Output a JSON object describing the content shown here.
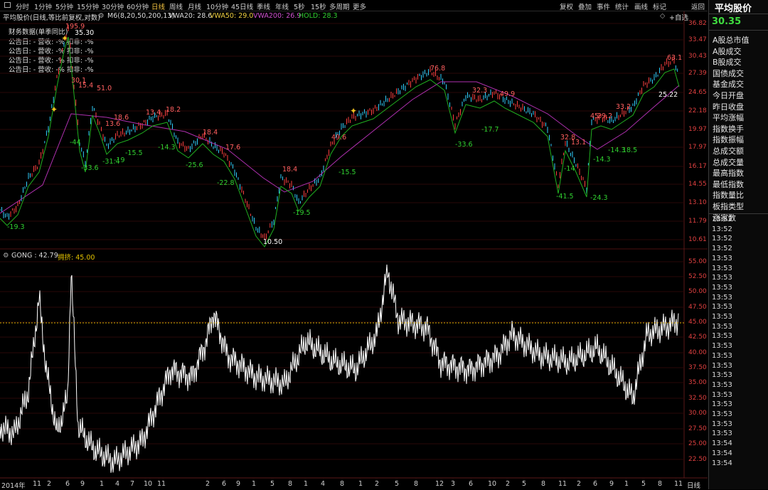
{
  "toolbar": {
    "timeframes": [
      "分时",
      "1分钟",
      "5分钟",
      "15分钟",
      "30分钟",
      "60分钟",
      "日线",
      "周线",
      "月线",
      "10分钟",
      "45日线",
      "季线",
      "年线",
      "5秒",
      "15秒",
      "多周期",
      "更多"
    ],
    "active": "日线",
    "right_buttons": [
      "复权",
      "叠加",
      "事件",
      "统计",
      "画线",
      "标记",
      "返回"
    ]
  },
  "main_chart": {
    "title": "平均股价(日线,等比前复权,对数)",
    "ma_label": "M6(8,20,50,200,13)",
    "vwa20": "VWA20: 28.6",
    "vwa50": "VWA50: 29.0",
    "vwa200": "VWA200: 26.9",
    "hold": "HOLD: 28.3",
    "add_fav": "+自选",
    "finance_title": "财务数据(单季同比)",
    "finance_rows": [
      "公告日: -    营收: -%  扣非: -%",
      "公告日: -    营收: -%  扣非: -%",
      "公告日: -    营收: -%  扣非: -%",
      "公告日: -    营收: -%  扣非: -%"
    ],
    "y_ticks": [
      "36.82",
      "33.47",
      "30.43",
      "27.39",
      "24.65",
      "22.18",
      "19.97",
      "17.97",
      "16.17",
      "14.55",
      "13.10",
      "11.79",
      "10.61"
    ],
    "annotations": {
      "red": [
        "195.9",
        "30.1",
        "15.4",
        "51.0",
        "13.6",
        "18.6",
        "13.4",
        "18.2",
        "18.4",
        "17.6",
        "18.4",
        "49.6",
        "76.8",
        "32.3",
        "49.9",
        "32.8",
        "13.1",
        "45",
        "29.2",
        "33.2",
        "63.1"
      ],
      "green": [
        "-19.3",
        "-44",
        "-33.6",
        "-31.4",
        "-19",
        "-15.5",
        "-14.3",
        "-25.6",
        "-22.8",
        "-19.5",
        "-15.5",
        "-33.6",
        "-17.7",
        "-41.5",
        "-14",
        "-24.3",
        "-14.3",
        "18.5",
        "-14.3"
      ],
      "white": [
        "35.30",
        "10.50",
        "25.22"
      ]
    }
  },
  "sub_chart": {
    "title": "GONG : 42.79",
    "param": "拥挤: 45.00",
    "y_ticks": [
      "55.00",
      "52.50",
      "50.00",
      "47.50",
      "45.00",
      "42.50",
      "40.00",
      "37.50",
      "35.00",
      "32.50",
      "30.00",
      "27.50",
      "25.00",
      "22.50"
    ]
  },
  "x_axis": {
    "labels": [
      "2014年",
      "11",
      "2",
      "6",
      "9",
      "1",
      "4",
      "7",
      "10",
      "11",
      "2",
      "6",
      "9",
      "1",
      "5",
      "8",
      "1",
      "4",
      "8",
      "1",
      "2",
      "5",
      "8",
      "12",
      "3",
      "6",
      "10",
      "2",
      "5",
      "8",
      "11",
      "2",
      "6",
      "9",
      "1",
      "5",
      "8",
      "11",
      "2"
    ],
    "period": "日线"
  },
  "right_panel": {
    "title": "平均股价",
    "price": "30.35",
    "items": [
      "A股总市值",
      "A股成交",
      "B股成交",
      "国债成交",
      "基金成交",
      "今日开盘",
      "昨日收盘",
      "平均涨幅",
      "指数换手",
      "指数振幅",
      "总成交额",
      "总成交量",
      "最高指数",
      "最低指数",
      "指数量比",
      "板指类型",
      "涨家数"
    ],
    "times": [
      "13:52",
      "13:52",
      "13:52",
      "13:52",
      "13:53",
      "13:53",
      "13:53",
      "13:53",
      "13:53",
      "13:53",
      "13:53",
      "13:53",
      "13:53",
      "13:53",
      "13:53",
      "13:53",
      "13:53",
      "13:53",
      "13:53",
      "13:53",
      "13:53",
      "13:53",
      "13:53",
      "13:54",
      "13:54",
      "13:54"
    ]
  },
  "colors": {
    "up": "#ff4040",
    "down": "#30d0ff",
    "ma20": "#22c022",
    "ma200": "#c040c0",
    "gong": "#ffffff",
    "threshold": "#d4b000"
  }
}
